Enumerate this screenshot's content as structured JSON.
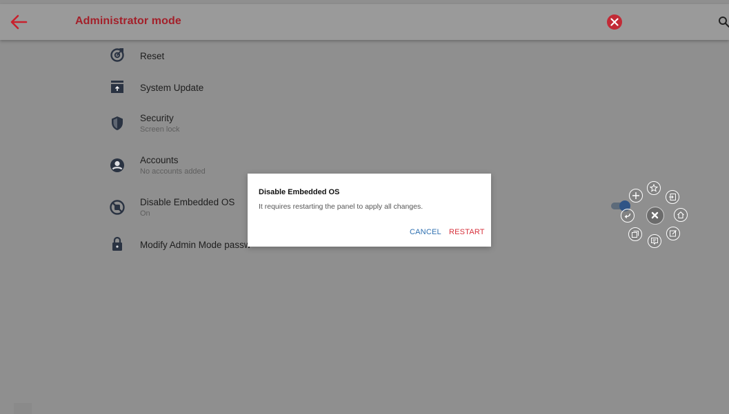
{
  "header": {
    "title": "Administrator mode",
    "back_icon": "arrow-left-icon",
    "close_icon": "close-circle-icon",
    "search_icon": "search-icon",
    "accent_color": "#a3202a"
  },
  "settings": {
    "items": [
      {
        "label": "Reset",
        "subtitle": "",
        "icon": "reset-icon"
      },
      {
        "label": "System Update",
        "subtitle": "",
        "icon": "system-update-icon"
      },
      {
        "label": "Security",
        "subtitle": "Screen lock",
        "icon": "shield-icon"
      },
      {
        "label": "Accounts",
        "subtitle": "No accounts added",
        "icon": "account-icon"
      },
      {
        "label": "Disable Embedded OS",
        "subtitle": "On",
        "icon": "disable-os-icon"
      },
      {
        "label": "Modify Admin Mode passw",
        "subtitle": "",
        "icon": "lock-icon"
      }
    ],
    "toggle_state": "on"
  },
  "dialog": {
    "title": "Disable Embedded OS",
    "message": "It requires restarting the panel to apply all changes.",
    "cancel_label": "CANCEL",
    "restart_label": "RESTART",
    "cancel_color": "#2d6fb0",
    "restart_color": "#d6303b"
  },
  "floating_menu": {
    "buttons": [
      "add-icon",
      "star-icon",
      "exit-icon",
      "home-icon",
      "edit-icon",
      "comment-icon",
      "window-icon",
      "back-icon",
      "close-icon"
    ]
  }
}
